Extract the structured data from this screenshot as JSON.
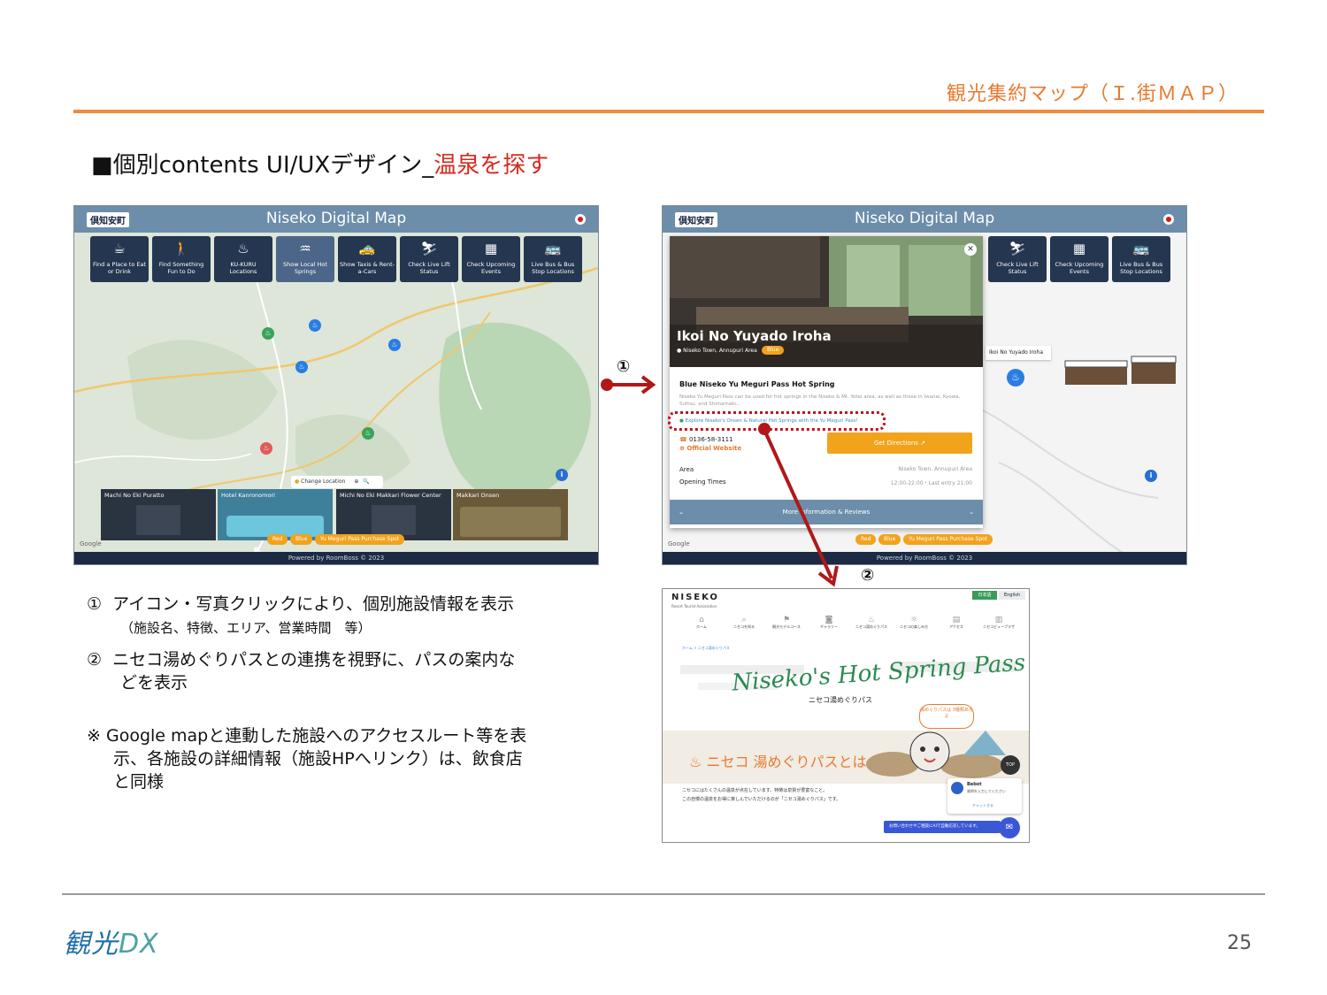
{
  "header": {
    "title": "観光集約マップ（Ｉ.街ＭＡＰ）",
    "section_prefix": "■個別contents UI/UXデザイン_",
    "section_highlight": "温泉を探す"
  },
  "app": {
    "logo_text": "倶知安町",
    "title": "Niseko Digital Map",
    "footer_text": "Powered by RoomBoss © 2023",
    "tiles": [
      {
        "icon": "☕",
        "label": "Find a Place to Eat or Drink"
      },
      {
        "icon": "🚶",
        "label": "Find Something Fun to Do"
      },
      {
        "icon": "♨",
        "label": "KU-KURU Locations"
      },
      {
        "icon": "♒",
        "label": "Show Local Hot Springs"
      },
      {
        "icon": "🚕",
        "label": "Show Taxis & Rent-a-Cars"
      },
      {
        "icon": "⛷",
        "label": "Check Live Lift Status"
      },
      {
        "icon": "▦",
        "label": "Check Upcoming Events"
      },
      {
        "icon": "🚌",
        "label": "Live Bus & Bus Stop Locations"
      }
    ],
    "change_location": "Change Location",
    "place_cards": [
      "Machi No Eki Puratto",
      "Hotel Kanronomori",
      "Michi No Eki Makkari Flower Center",
      "Makkari Onsen"
    ],
    "chips": {
      "red": "Red",
      "blue": "Blue",
      "pass": "Yu Meguri Pass Purchase Spot"
    },
    "google": "Google"
  },
  "detail": {
    "name": "Ikoi No Yuyado Iroha",
    "location": "Niseko Town, Annupuri Area",
    "badge": "Blue",
    "section_title": "Blue Niseko Yu Meguri Pass Hot Spring",
    "description": "Niseko Yu Meguri Pass can be used for hot springs in the Niseko & Mt. Yotei area, as well as those in Iwanai, Kyowa, Suttsu, and Shimamaki...",
    "explore_link": "Explore Niseko's Onsen & Natural Hot Springs with the Yu Meguri Pass!",
    "phone": "0136-58-3111",
    "website": "Official Website",
    "directions": "Get Directions",
    "area_label": "Area",
    "area_value": "Niseko Town, Annupuri Area",
    "hours_label": "Opening Times",
    "hours_value": "12:00-22:00・Last entry 21:00",
    "more": "More Information & Reviews",
    "tooltip": "Ikoi No Yuyado Iroha"
  },
  "markers": {
    "one": "①",
    "two": "②"
  },
  "site": {
    "logo": "NISEKO",
    "logo_sub": "Resort Tourist Association",
    "lang_ja": "日本語",
    "lang_en": "English",
    "nav": [
      "ホーム",
      "ニセコを知る",
      "観光モデルコース",
      "ギャラリー",
      "ニセコ湯めぐりパス",
      "ニセコの楽しみ方",
      "アクセス",
      "ニセコビュープラザ"
    ],
    "breadcrumb": "ホーム > ニセコ湯めぐりパス",
    "hero_title": "Niseko's Hot Spring Pass",
    "hero_sub": "ニセコ湯めぐりパス",
    "bubble": "湯めぐりパスは 3種類あるよ",
    "band_title": "ニセコ 湯めぐりパスとは",
    "body1": "ニセコにはたくさんの温泉が点在しています。特徴は泉質が豊富なこと。",
    "body2": "この自慢の温泉をお得に楽しんでいただけるのが「ニセコ湯めぐりパス」です。",
    "chat_name": "Bebot",
    "chat_msg": "質問を入力してください",
    "chat_link": "チャットする",
    "chat_banner": "お問い合わせやご相談にAIで自動応答しています。",
    "top": "TOP"
  },
  "notes": {
    "n1_num": "①",
    "n1": "アイコン・写真クリックにより、個別施設情報を表示",
    "n1_sub": "（施設名、特徴、エリア、営業時間　等）",
    "n2_num": "②",
    "n2_line1": "ニセコ湯めぐりパスとの連携を視野に、パスの案内な",
    "n2_line2": "どを表示",
    "n3_mark": "※",
    "n3_line1": "Google mapと連動した施設へのアクセスルート等を表",
    "n3_line2": "示、各施設の詳細情報（施設HPへリンク）は、飲食店",
    "n3_line3": "と同様"
  },
  "footer": {
    "brand": "観光",
    "brand_dx": "DX",
    "page": "25"
  },
  "colors": {
    "accent": "#ee8a3f",
    "highlight": "#d62a1f",
    "app_header": "#6c8eaa",
    "tile": "#243650",
    "directions": "#f2a31c"
  }
}
